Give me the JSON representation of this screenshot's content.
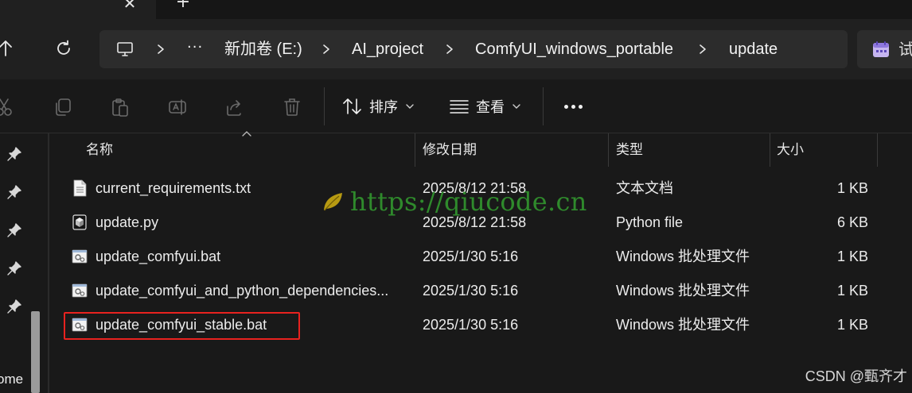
{
  "tabs": {
    "close_glyph": "✕",
    "new_glyph": "+"
  },
  "address": {
    "ellipsis": "···",
    "crumbs": [
      "新加卷 (E:)",
      "AI_project",
      "ComfyUI_windows_portable",
      "update"
    ],
    "search_text": "试"
  },
  "command_bar": {
    "sort_label": "排序",
    "view_label": "查看"
  },
  "nav_pane": {
    "partial_label": "ome"
  },
  "columns": {
    "name": "名称",
    "modified": "修改日期",
    "type": "类型",
    "size": "大小"
  },
  "files": [
    {
      "name": "current_requirements.txt",
      "modified": "2025/8/12 21:58",
      "type": "文本文档",
      "size": "1 KB",
      "icon": "text-file-icon"
    },
    {
      "name": "update.py",
      "modified": "2025/8/12 21:58",
      "type": "Python file",
      "size": "6 KB",
      "icon": "python-file-icon"
    },
    {
      "name": "update_comfyui.bat",
      "modified": "2025/1/30 5:16",
      "type": "Windows 批处理文件",
      "size": "1 KB",
      "icon": "batch-file-icon"
    },
    {
      "name": "update_comfyui_and_python_dependencies...",
      "modified": "2025/1/30 5:16",
      "type": "Windows 批处理文件",
      "size": "1 KB",
      "icon": "batch-file-icon"
    },
    {
      "name": "update_comfyui_stable.bat",
      "modified": "2025/1/30 5:16",
      "type": "Windows 批处理文件",
      "size": "1 KB",
      "icon": "batch-file-icon"
    }
  ],
  "highlighted_file": "update_comfyui_stable.bat",
  "watermarks": {
    "url": "https://qiucode.cn",
    "csdn": "CSDN @甄齐才"
  },
  "colors": {
    "background": "#191919",
    "highlight": "#e8221f",
    "watermark": "#2f8a2c"
  }
}
